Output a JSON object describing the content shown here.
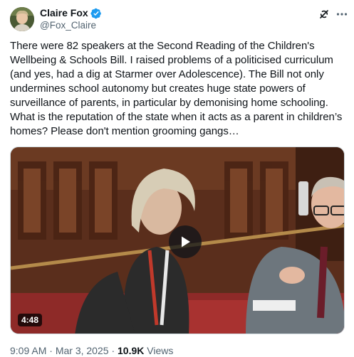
{
  "author": {
    "display_name": "Claire Fox",
    "handle": "@Fox_Claire",
    "verified": true
  },
  "post": {
    "text": "There were 82 speakers at the Second Reading of the Children's Wellbeing & Schools Bill. I raised problems of a politicised curriculum (and yes, had a dig at Starmer over Adolescence). The Bill not only undermines school autonomy but creates huge state powers of surveillance of parents, in particular by demonising home schooling. What is the reputation of the state when it acts as a parent in children’s homes? Please don't mention grooming gangs…",
    "time": "9:09 AM",
    "date": "Mar 3, 2025",
    "separator": "·",
    "views_count": "10.9K",
    "views_label": "Views"
  },
  "video": {
    "duration": "4:48"
  },
  "icons": {
    "verified": "verified-badge-icon",
    "grok": "grok-icon",
    "more": "more-options-icon",
    "play": "play-icon"
  },
  "colors": {
    "verified": "#1d9bf0",
    "secondary_text": "#536471",
    "primary_text": "#0f1419"
  }
}
